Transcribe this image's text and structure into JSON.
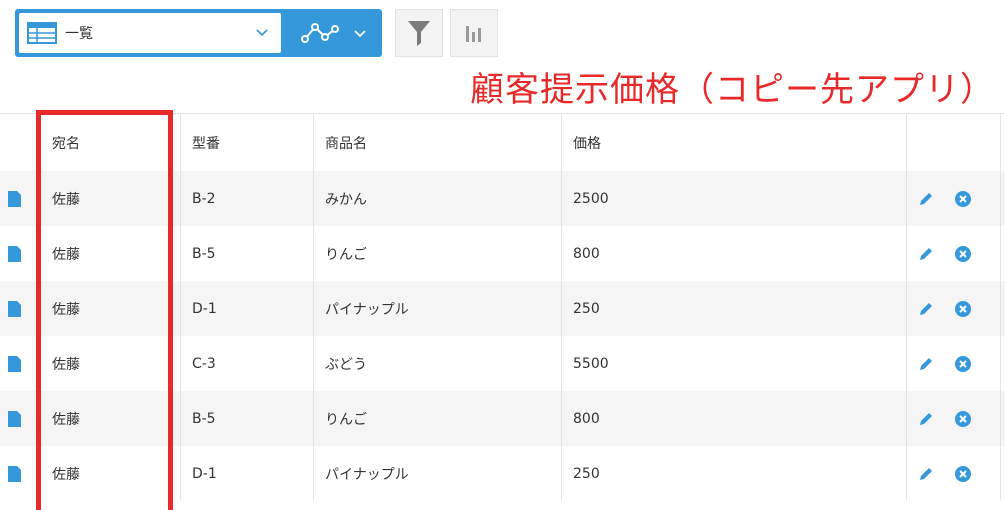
{
  "toolbar": {
    "view_name": "一覧"
  },
  "annotation": "顧客提示価格（コピー先アプリ）",
  "table": {
    "headers": [
      "宛名",
      "型番",
      "商品名",
      "価格"
    ],
    "rows": [
      {
        "name": "佐藤",
        "model": "B-2",
        "product": "みかん",
        "price": "2500"
      },
      {
        "name": "佐藤",
        "model": "B-5",
        "product": "りんご",
        "price": "800"
      },
      {
        "name": "佐藤",
        "model": "D-1",
        "product": "パイナップル",
        "price": "250"
      },
      {
        "name": "佐藤",
        "model": "C-3",
        "product": "ぶどう",
        "price": "5500"
      },
      {
        "name": "佐藤",
        "model": "B-5",
        "product": "りんご",
        "price": "800"
      },
      {
        "name": "佐藤",
        "model": "D-1",
        "product": "パイナップル",
        "price": "250"
      }
    ]
  },
  "colors": {
    "accent": "#3498db",
    "annotation_red": "#e8292a",
    "stripe": "#f5f5f5"
  },
  "icons": [
    "table-icon",
    "chevron-down-icon",
    "graph-icon",
    "filter-icon",
    "bar-chart-icon",
    "document-icon",
    "pencil-icon",
    "delete-icon"
  ]
}
